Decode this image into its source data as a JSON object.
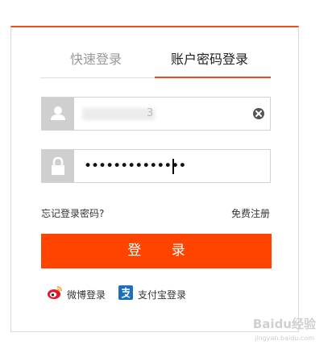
{
  "tabs": {
    "quick_login": "快速登录",
    "account_login": "账户密码登录"
  },
  "username": {
    "visible_suffix": "3"
  },
  "password": {
    "masked_value": "••••••••••••••"
  },
  "links": {
    "forgot_password": "忘记登录密码?",
    "register": "免费注册"
  },
  "login_button": "登 录",
  "social": {
    "weibo": "微博登录",
    "alipay": "支付宝登录"
  },
  "watermark": {
    "brand": "Baidu经验",
    "sub": "jingyan.baidu.com"
  },
  "colors": {
    "accent": "#ff4400",
    "icon_box": "#cfcfcf"
  },
  "icons": {
    "user": "user-icon",
    "lock": "lock-icon",
    "clear": "clear-icon",
    "weibo": "weibo-icon",
    "alipay": "alipay-icon"
  }
}
